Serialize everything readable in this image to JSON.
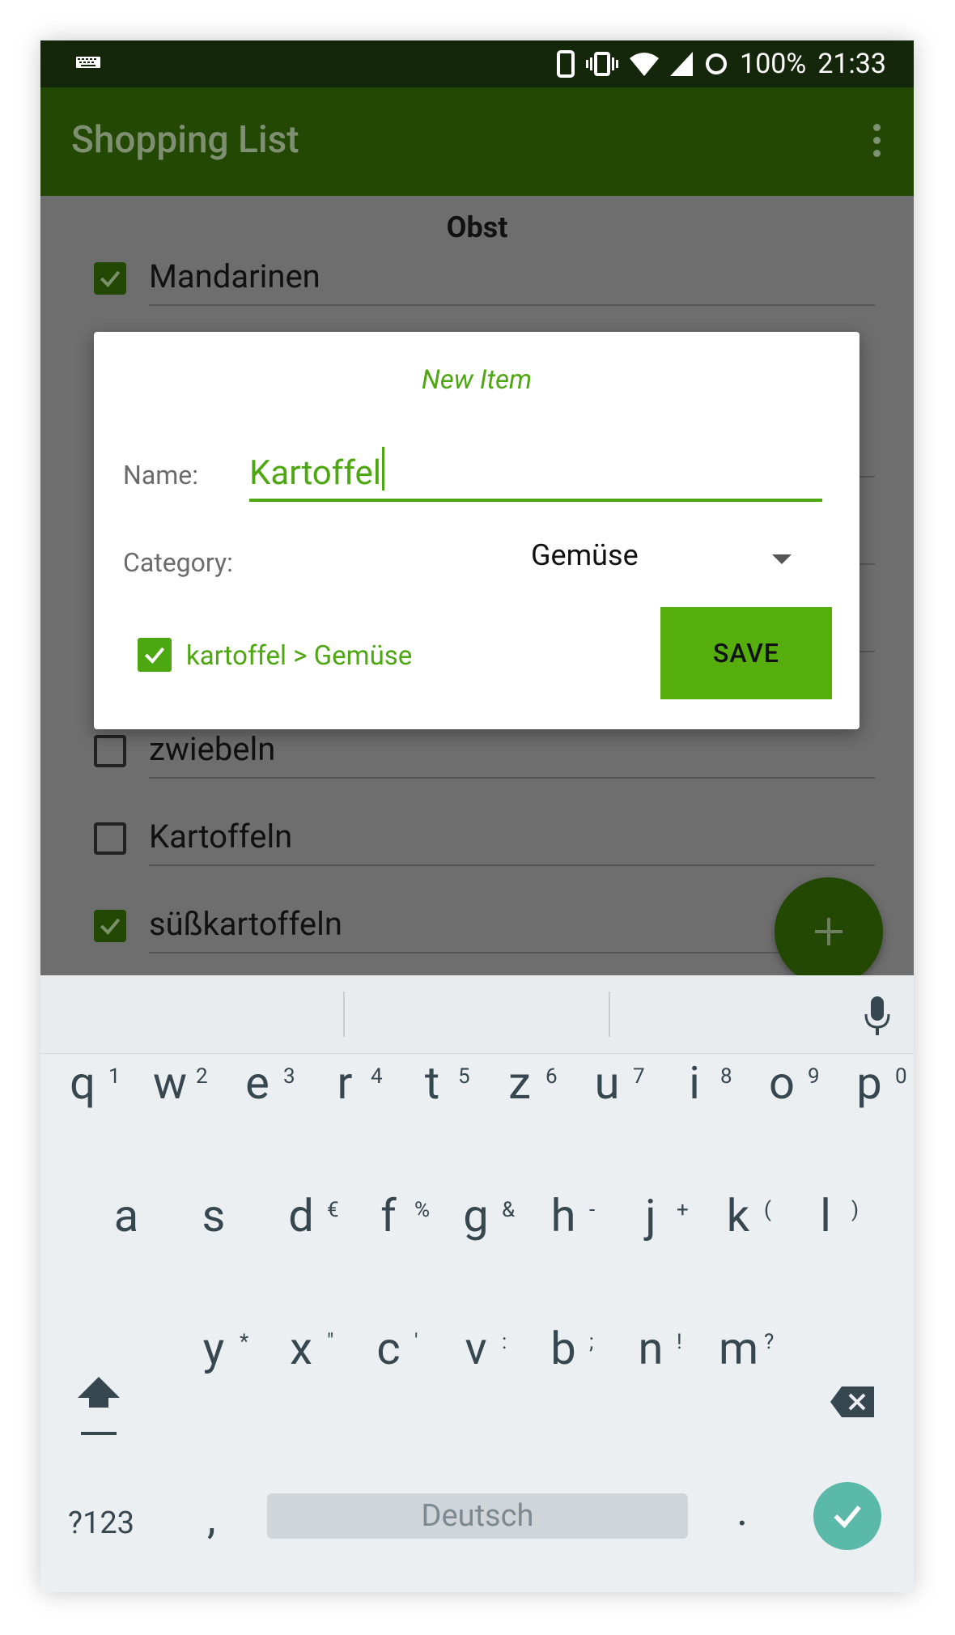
{
  "status_bar": {
    "battery": "100%",
    "time": "21:33",
    "icons": [
      "keyboard-icon",
      "phone-icon",
      "vibrate-icon",
      "wifi-icon",
      "signal-icon",
      "sync-icon"
    ]
  },
  "toolbar": {
    "title": "Shopping List",
    "overflow_icon": "more-vert-icon"
  },
  "list": {
    "category_header": "Obst",
    "items": [
      {
        "label": "Mandarinen",
        "checked": true
      },
      {
        "label": "zwiebeln",
        "checked": false
      },
      {
        "label": "Kartoffeln",
        "checked": false
      },
      {
        "label": "süßkartoffeln",
        "checked": true
      }
    ]
  },
  "fab": {
    "icon": "plus-icon"
  },
  "dialog": {
    "title": "New Item",
    "name_label": "Name:",
    "name_value": "Kartoffel",
    "category_label": "Category:",
    "category_value": "Gemüse",
    "remember_label": "kartoffel > Gemüse",
    "remember_checked": true,
    "save_label": "SAVE"
  },
  "keyboard": {
    "row1": [
      "q",
      "w",
      "e",
      "r",
      "t",
      "z",
      "u",
      "i",
      "o",
      "p"
    ],
    "row1_hints": [
      "1",
      "2",
      "3",
      "4",
      "5",
      "6",
      "7",
      "8",
      "9",
      "0"
    ],
    "row2": [
      "a",
      "s",
      "d",
      "f",
      "g",
      "h",
      "j",
      "k",
      "l"
    ],
    "row2_hints": [
      "",
      "",
      "€",
      "%",
      "&",
      "-",
      "+",
      "(",
      ")"
    ],
    "row3": [
      "y",
      "x",
      "c",
      "v",
      "b",
      "n",
      "m"
    ],
    "row3_hints": [
      "*",
      "\"",
      "'",
      ":",
      ";",
      "!",
      "?"
    ],
    "symbols_label": "?123",
    "comma": ",",
    "space_label": "Deutsch",
    "period": ".",
    "icons": {
      "shift": "shift-icon",
      "delete": "backspace-icon",
      "enter": "checkmark-icon",
      "mic": "mic-icon"
    }
  },
  "colors": {
    "status_bar": "#14270a",
    "toolbar": "#234804",
    "accent": "#4da710",
    "save_button": "#55ae0b",
    "fab": "#234804",
    "enter_key": "#5ab9a8"
  }
}
